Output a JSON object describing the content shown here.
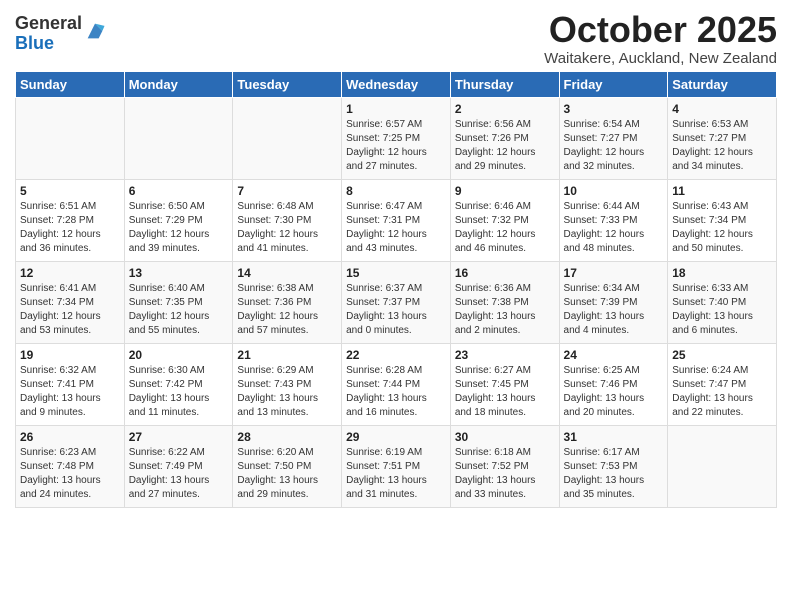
{
  "header": {
    "logo_general": "General",
    "logo_blue": "Blue",
    "month_title": "October 2025",
    "subtitle": "Waitakere, Auckland, New Zealand"
  },
  "days_of_week": [
    "Sunday",
    "Monday",
    "Tuesday",
    "Wednesday",
    "Thursday",
    "Friday",
    "Saturday"
  ],
  "weeks": [
    [
      {
        "num": "",
        "info": ""
      },
      {
        "num": "",
        "info": ""
      },
      {
        "num": "",
        "info": ""
      },
      {
        "num": "1",
        "info": "Sunrise: 6:57 AM\nSunset: 7:25 PM\nDaylight: 12 hours\nand 27 minutes."
      },
      {
        "num": "2",
        "info": "Sunrise: 6:56 AM\nSunset: 7:26 PM\nDaylight: 12 hours\nand 29 minutes."
      },
      {
        "num": "3",
        "info": "Sunrise: 6:54 AM\nSunset: 7:27 PM\nDaylight: 12 hours\nand 32 minutes."
      },
      {
        "num": "4",
        "info": "Sunrise: 6:53 AM\nSunset: 7:27 PM\nDaylight: 12 hours\nand 34 minutes."
      }
    ],
    [
      {
        "num": "5",
        "info": "Sunrise: 6:51 AM\nSunset: 7:28 PM\nDaylight: 12 hours\nand 36 minutes."
      },
      {
        "num": "6",
        "info": "Sunrise: 6:50 AM\nSunset: 7:29 PM\nDaylight: 12 hours\nand 39 minutes."
      },
      {
        "num": "7",
        "info": "Sunrise: 6:48 AM\nSunset: 7:30 PM\nDaylight: 12 hours\nand 41 minutes."
      },
      {
        "num": "8",
        "info": "Sunrise: 6:47 AM\nSunset: 7:31 PM\nDaylight: 12 hours\nand 43 minutes."
      },
      {
        "num": "9",
        "info": "Sunrise: 6:46 AM\nSunset: 7:32 PM\nDaylight: 12 hours\nand 46 minutes."
      },
      {
        "num": "10",
        "info": "Sunrise: 6:44 AM\nSunset: 7:33 PM\nDaylight: 12 hours\nand 48 minutes."
      },
      {
        "num": "11",
        "info": "Sunrise: 6:43 AM\nSunset: 7:34 PM\nDaylight: 12 hours\nand 50 minutes."
      }
    ],
    [
      {
        "num": "12",
        "info": "Sunrise: 6:41 AM\nSunset: 7:34 PM\nDaylight: 12 hours\nand 53 minutes."
      },
      {
        "num": "13",
        "info": "Sunrise: 6:40 AM\nSunset: 7:35 PM\nDaylight: 12 hours\nand 55 minutes."
      },
      {
        "num": "14",
        "info": "Sunrise: 6:38 AM\nSunset: 7:36 PM\nDaylight: 12 hours\nand 57 minutes."
      },
      {
        "num": "15",
        "info": "Sunrise: 6:37 AM\nSunset: 7:37 PM\nDaylight: 13 hours\nand 0 minutes."
      },
      {
        "num": "16",
        "info": "Sunrise: 6:36 AM\nSunset: 7:38 PM\nDaylight: 13 hours\nand 2 minutes."
      },
      {
        "num": "17",
        "info": "Sunrise: 6:34 AM\nSunset: 7:39 PM\nDaylight: 13 hours\nand 4 minutes."
      },
      {
        "num": "18",
        "info": "Sunrise: 6:33 AM\nSunset: 7:40 PM\nDaylight: 13 hours\nand 6 minutes."
      }
    ],
    [
      {
        "num": "19",
        "info": "Sunrise: 6:32 AM\nSunset: 7:41 PM\nDaylight: 13 hours\nand 9 minutes."
      },
      {
        "num": "20",
        "info": "Sunrise: 6:30 AM\nSunset: 7:42 PM\nDaylight: 13 hours\nand 11 minutes."
      },
      {
        "num": "21",
        "info": "Sunrise: 6:29 AM\nSunset: 7:43 PM\nDaylight: 13 hours\nand 13 minutes."
      },
      {
        "num": "22",
        "info": "Sunrise: 6:28 AM\nSunset: 7:44 PM\nDaylight: 13 hours\nand 16 minutes."
      },
      {
        "num": "23",
        "info": "Sunrise: 6:27 AM\nSunset: 7:45 PM\nDaylight: 13 hours\nand 18 minutes."
      },
      {
        "num": "24",
        "info": "Sunrise: 6:25 AM\nSunset: 7:46 PM\nDaylight: 13 hours\nand 20 minutes."
      },
      {
        "num": "25",
        "info": "Sunrise: 6:24 AM\nSunset: 7:47 PM\nDaylight: 13 hours\nand 22 minutes."
      }
    ],
    [
      {
        "num": "26",
        "info": "Sunrise: 6:23 AM\nSunset: 7:48 PM\nDaylight: 13 hours\nand 24 minutes."
      },
      {
        "num": "27",
        "info": "Sunrise: 6:22 AM\nSunset: 7:49 PM\nDaylight: 13 hours\nand 27 minutes."
      },
      {
        "num": "28",
        "info": "Sunrise: 6:20 AM\nSunset: 7:50 PM\nDaylight: 13 hours\nand 29 minutes."
      },
      {
        "num": "29",
        "info": "Sunrise: 6:19 AM\nSunset: 7:51 PM\nDaylight: 13 hours\nand 31 minutes."
      },
      {
        "num": "30",
        "info": "Sunrise: 6:18 AM\nSunset: 7:52 PM\nDaylight: 13 hours\nand 33 minutes."
      },
      {
        "num": "31",
        "info": "Sunrise: 6:17 AM\nSunset: 7:53 PM\nDaylight: 13 hours\nand 35 minutes."
      },
      {
        "num": "",
        "info": ""
      }
    ]
  ]
}
